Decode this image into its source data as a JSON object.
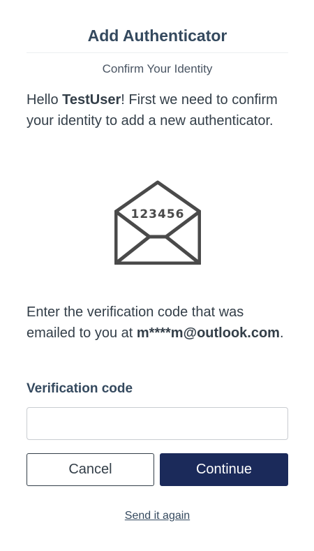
{
  "header": {
    "title": "Add Authenticator",
    "subtitle": "Confirm Your Identity"
  },
  "intro": {
    "greeting": "Hello ",
    "username": "TestUser",
    "message": "! First we need to confirm your identity to add a new authenticator."
  },
  "illustration": {
    "icon": "envelope-icon",
    "code_text": "123456",
    "color": "#4a4a4a"
  },
  "instructions": {
    "text": "Enter the verification code that was emailed to you at ",
    "email": "m****m@outlook.com",
    "suffix": "."
  },
  "form": {
    "code_label": "Verification code",
    "code_value": "",
    "code_placeholder": ""
  },
  "buttons": {
    "cancel_label": "Cancel",
    "continue_label": "Continue"
  },
  "links": {
    "resend_label": "Send it again"
  },
  "colors": {
    "primary": "#1b2a5a",
    "heading": "#34495e",
    "text": "#333e48"
  }
}
